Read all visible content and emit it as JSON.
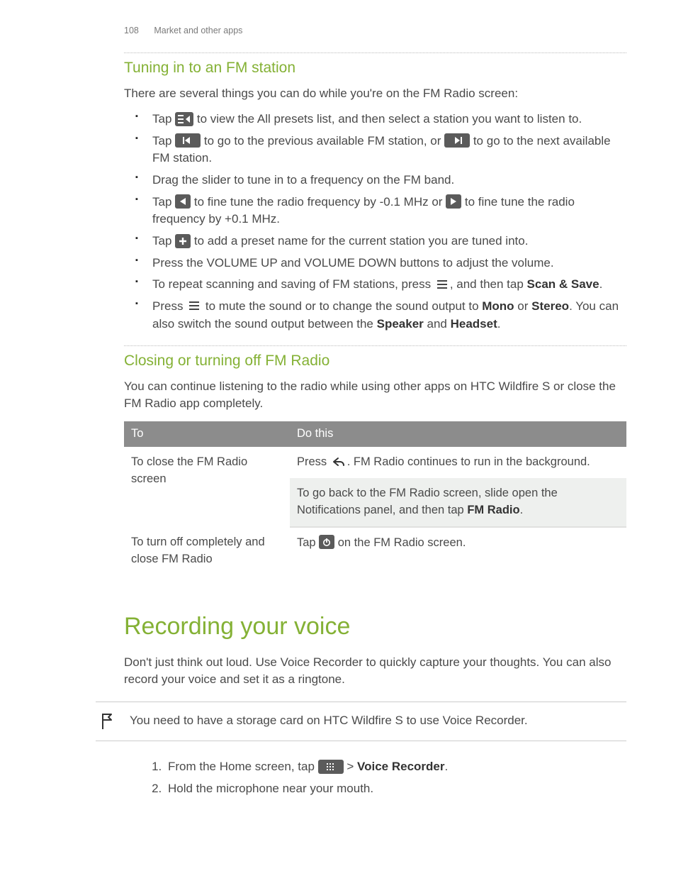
{
  "header": {
    "page_number": "108",
    "section": "Market and other apps"
  },
  "s1_title": "Tuning in to an FM station",
  "s1_intro": "There are several things you can do while you're on the FM Radio screen:",
  "b1a": "Tap ",
  "b1b": " to view the All presets list, and then select a station you want to listen to.",
  "b2a": "Tap ",
  "b2b": " to go to the previous available FM station, or ",
  "b2c": " to go to the next available FM station.",
  "b3": "Drag the slider to tune in to a frequency on the FM band.",
  "b4a": "Tap ",
  "b4b": " to fine tune the radio frequency by -0.1 MHz or ",
  "b4c": " to fine tune the radio frequency by +0.1 MHz.",
  "b5a": "Tap ",
  "b5b": " to add a preset name for the current station you are tuned into.",
  "b6": "Press the VOLUME UP and VOLUME DOWN buttons to adjust the volume.",
  "b7a": "To repeat scanning and saving of FM stations, press ",
  "b7b": ", and then tap ",
  "b7c": "Scan & Save",
  "b7d": ".",
  "b8a": "Press ",
  "b8b": " to mute the sound or to change the sound output to ",
  "b8c": "Mono",
  "b8d": " or ",
  "b8e": "Stereo",
  "b8f": ". You can also switch the sound output between the ",
  "b8g": "Speaker",
  "b8h": " and ",
  "b8i": "Headset",
  "b8j": ".",
  "s2_title": "Closing or turning off FM Radio",
  "s2_intro": "You can continue listening to the radio while using other apps on HTC Wildfire S or close the FM Radio app completely.",
  "th_to": "To",
  "th_do": "Do this",
  "r1_to": "To close the FM Radio screen",
  "r1a": "Press ",
  "r1b": ". FM Radio continues to run in the background.",
  "r1c": "To go back to the FM Radio screen, slide open the Notifications panel, and then tap ",
  "r1d": "FM Radio",
  "r1e": ".",
  "r2_to": "To turn off completely and close FM Radio",
  "r2a": "Tap ",
  "r2b": " on the FM Radio screen.",
  "chapter": "Recording your voice",
  "ch_intro": "Don't just think out loud. Use Voice Recorder to quickly capture your thoughts. You can also record your voice and set it as a ringtone.",
  "note": "You need to have a storage card on HTC Wildfire S to use Voice Recorder.",
  "st1a": "From the Home screen, tap ",
  "st1b": " > ",
  "st1c": "Voice Recorder",
  "st1d": ".",
  "st2": "Hold the microphone near your mouth."
}
